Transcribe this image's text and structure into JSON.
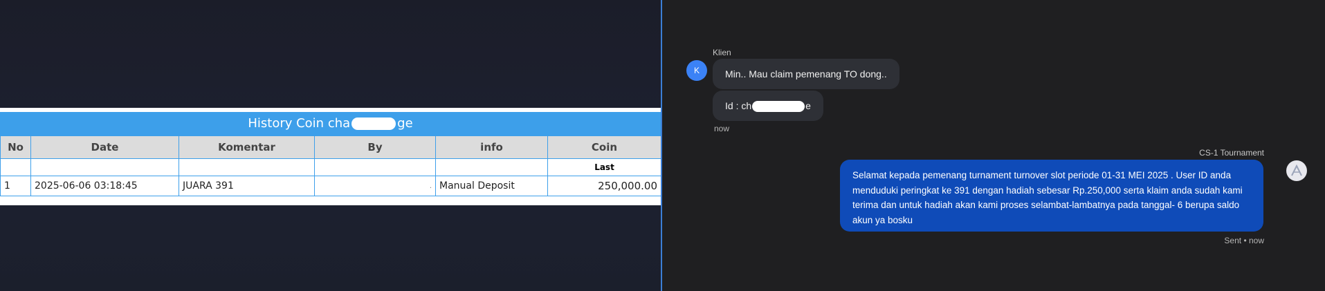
{
  "history_table": {
    "title_prefix": "History Coin cha",
    "title_suffix": "ge",
    "columns": [
      "No",
      "Date",
      "Komentar",
      "By",
      "info",
      "Coin"
    ],
    "sub_header_label": "Last",
    "rows": [
      {
        "no": "1",
        "date": "2025-06-06 03:18:45",
        "komentar": "JUARA 391",
        "by": ".",
        "info": "Manual Deposit",
        "coin": "250,000.00"
      }
    ],
    "colors": {
      "header_bg": "#3d9fea",
      "coin_value": "#1d8a1d"
    }
  },
  "chat": {
    "client": {
      "name": "Klien",
      "avatar_letter": "K",
      "messages": [
        "Min.. Mau claim pemenang TO dong.."
      ],
      "id_prefix": "Id : ch",
      "id_suffix": "e",
      "timestamp": "now"
    },
    "agent": {
      "name": "CS-1 Tournament",
      "message": "Selamat kepada pemenang turnament turnover slot periode 01-31 MEI 2025 . User ID anda menduduki peringkat ke 391 dengan hadiah sebesar Rp.250,000 serta klaim anda sudah kami terima dan untuk hadiah akan kami proses selambat-lambatnya pada tanggal- 6 berupa saldo akun ya bosku",
      "status": "Sent • now",
      "bubble_color": "#0f4bb8"
    }
  }
}
